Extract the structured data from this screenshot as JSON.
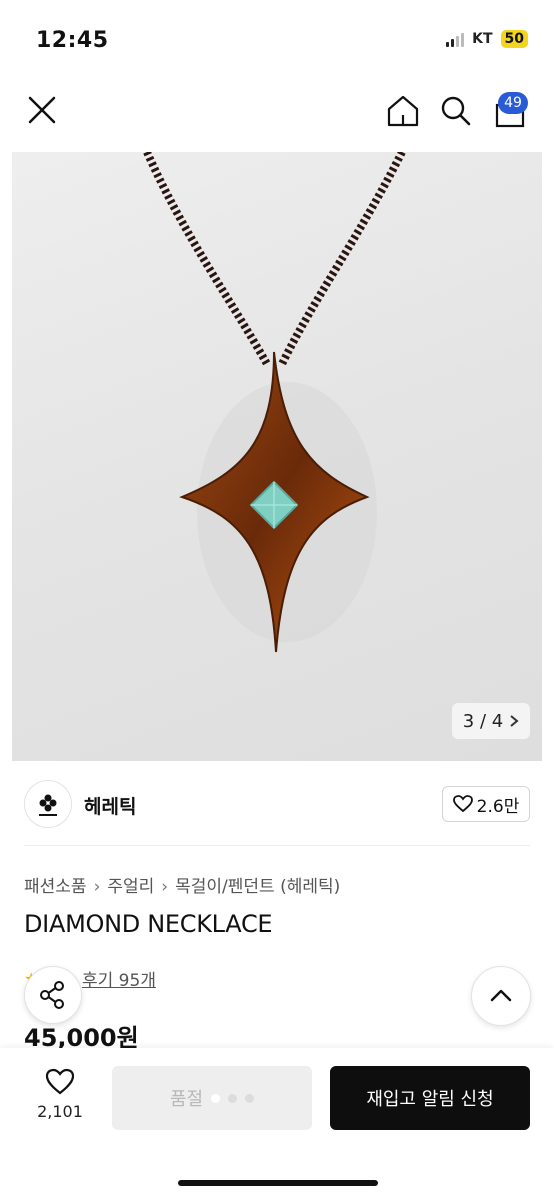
{
  "status_bar": {
    "time": "12:45",
    "carrier": "KT",
    "battery": "50"
  },
  "header": {
    "cart_count": "49"
  },
  "product_image": {
    "counter": "3 / 4"
  },
  "brand": {
    "name": "헤레틱",
    "likes": "2.6만"
  },
  "breadcrumb": [
    "패션소품",
    "주얼리",
    "목걸이/펜던트 (헤레틱)"
  ],
  "product": {
    "title": "DIAMOND NECKLACE",
    "review_link": "후기 95개",
    "price": "45,000원"
  },
  "bottom_bar": {
    "wish_count": "2,101",
    "soldout_label": "품절",
    "restock_label": "재입고 알림 신청"
  },
  "icons": [
    "close-icon",
    "home-icon",
    "search-icon",
    "cart-icon",
    "chevron-right-icon",
    "heart-icon",
    "share-icon",
    "chevron-up-icon"
  ]
}
